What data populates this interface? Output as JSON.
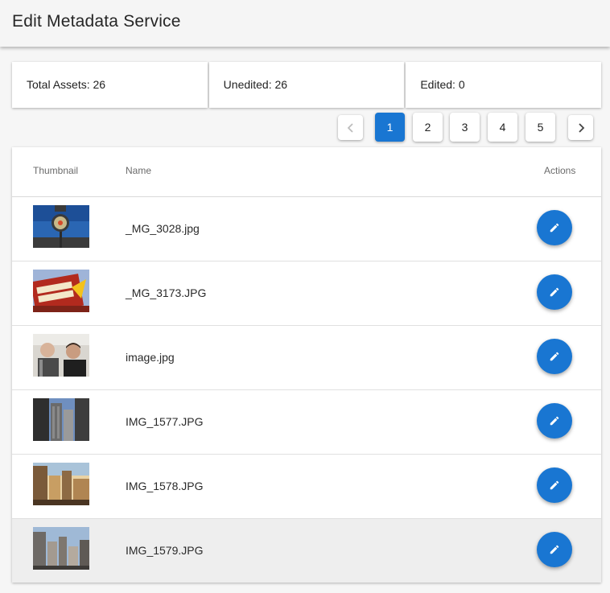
{
  "app": {
    "title": "Edit Metadata Service"
  },
  "stats": {
    "total": "Total Assets: 26",
    "unedited": "Unedited: 26",
    "edited": "Edited: 0"
  },
  "pagination": {
    "pages": [
      "1",
      "2",
      "3",
      "4",
      "5"
    ],
    "current_page": "1",
    "prev_icon": "chevron-left-icon",
    "next_icon": "chevron-right-icon"
  },
  "table": {
    "columns": {
      "thumbnail": "Thumbnail",
      "name": "Name",
      "actions": "Actions"
    },
    "rows": [
      {
        "name": "_MG_3028.jpg",
        "thumbnail": "clock-sign-sky"
      },
      {
        "name": "_MG_3173.JPG",
        "thumbnail": "in-n-out-burger-sign"
      },
      {
        "name": "image.jpg",
        "thumbnail": "two-people-selfie"
      },
      {
        "name": "IMG_1577.JPG",
        "thumbnail": "city-skyscrapers"
      },
      {
        "name": "IMG_1578.JPG",
        "thumbnail": "city-buildings-sunset"
      },
      {
        "name": "IMG_1579.JPG",
        "thumbnail": "city-buildings-sky"
      }
    ],
    "row_action_icon": "pencil-icon"
  },
  "colors": {
    "accent": "#1976d2",
    "hover_row": "#eeeeee",
    "background": "#f6f6f6"
  }
}
